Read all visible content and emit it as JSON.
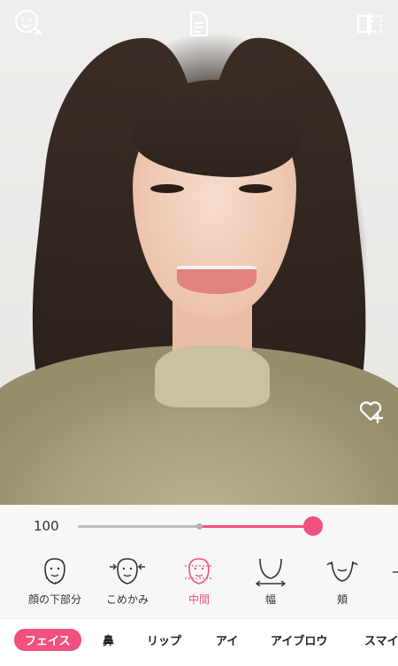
{
  "topbar": {
    "left_icon": "face-scan-icon",
    "center_icon": "document-icon",
    "right_icon": "compare-icon"
  },
  "photo": {
    "favorite_icon": "heart-plus-icon"
  },
  "slider": {
    "value": "100",
    "level_percent": 100,
    "accent": "#f0517f"
  },
  "tools": [
    {
      "label": "顔の下部分",
      "icon": "lower-face-icon",
      "active": false
    },
    {
      "label": "こめかみ",
      "icon": "temple-icon",
      "active": false
    },
    {
      "label": "中間",
      "icon": "midface-icon",
      "active": true
    },
    {
      "label": "幅",
      "icon": "face-width-icon",
      "active": false
    },
    {
      "label": "頬",
      "icon": "cheek-icon",
      "active": false
    }
  ],
  "tabs": [
    {
      "label": "フェイス",
      "active": true
    },
    {
      "label": "鼻",
      "active": false
    },
    {
      "label": "リップ",
      "active": false
    },
    {
      "label": "アイ",
      "active": false
    },
    {
      "label": "アイブロウ",
      "active": false
    },
    {
      "label": "スマイ",
      "active": false
    }
  ]
}
